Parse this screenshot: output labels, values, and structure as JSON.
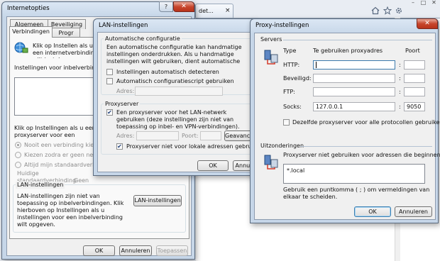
{
  "browser": {
    "tab_title": "det...",
    "tab_close": "×",
    "icons": [
      "home-icon",
      "star-icon",
      "gear-icon"
    ],
    "win_controls": {
      "minimize": "–",
      "maximize": "□",
      "close": "✕"
    }
  },
  "internet_options": {
    "title": "Internetopties",
    "help": "?",
    "close": "✕",
    "tabs": [
      "Algemeen",
      "Beveiliging",
      "Verbindingen",
      "Progr"
    ],
    "setup_text": "Klik op Instellen als u een internetverbinding wilt instal",
    "dialup_label": "Instellingen voor inbelverbindingen e",
    "proxy_hint": "Klik op Instellingen als u een proxyserver voor een verbinding wilt instellen.",
    "radios": [
      "Nooit een verbinding kiezen",
      "Kiezen zodra er geen netwerkv",
      "Altijd mijn standaardverbinding"
    ],
    "default_label": "Huidige standaardverbinding:",
    "default_value": "Geen",
    "lan_group": "LAN-instellingen",
    "lan_text": "LAN-instellingen zijn niet van toepassing op inbelverbindingen. Klik hierboven op Instellingen als u instellingen voor een inbelverbinding wilt opgeven.",
    "lan_button": "LAN-instellingen",
    "ok": "OK",
    "cancel": "Annuleren",
    "apply": "Toepassen"
  },
  "lan": {
    "title": "LAN-instellingen",
    "auto_group": "Automatische configuratie",
    "auto_text": "Een automatische configuratie kan handmatige instellingen onderdrukken. Als u handmatige instellingen wilt gebruiken, dient automatische configuratie uit te schakelen.",
    "detect": "Instellingen automatisch detecteren",
    "script": "Automatisch configuratiescript gebruiken",
    "address": "Adres:",
    "proxy_group": "Proxyserver",
    "proxy_use": "Een proxyserver voor het LAN-netwerk gebruiken (deze instellingen zijn niet van toepassing op inbel- en VPN-verbindingen).",
    "proxy_address": "Adres:",
    "port": "Poort:",
    "advanced": "Geavancee",
    "bypass": "Proxyserver niet voor lokale adressen gebruiken",
    "ok": "OK",
    "cancel": "Annul"
  },
  "proxy": {
    "title": "Proxy-instellingen",
    "close": "✕",
    "servers_group": "Servers",
    "col_type": "Type",
    "col_address": "Te gebruiken proxyadres",
    "col_port": "Poort",
    "rows": [
      {
        "label": "HTTP:",
        "address": "",
        "port": ""
      },
      {
        "label": "Beveiligd:",
        "address": "",
        "port": ""
      },
      {
        "label": "FTP:",
        "address": "",
        "port": ""
      },
      {
        "label": "Socks:",
        "address": "127.0.0.1",
        "port": "9050"
      }
    ],
    "colon": ":",
    "same_for_all": "Dezelfde proxyserver voor alle protocollen gebruiken",
    "exceptions_group": "Uitzonderingen",
    "exceptions_label": "Proxyserver niet gebruiken voor adressen die beginnen met:",
    "exceptions_value": "*.local",
    "hint": "Gebruik een puntkomma ( ; ) om vermeldingen van elkaar te scheiden.",
    "ok": "OK",
    "cancel": "Annuleren"
  }
}
